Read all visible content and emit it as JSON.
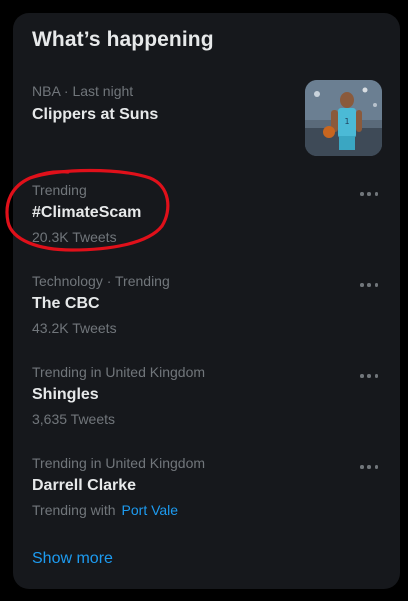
{
  "panel": {
    "title": "What’s happening",
    "show_more": "Show more"
  },
  "trends": [
    {
      "meta": "NBA · Last night",
      "name": "Clippers at Suns",
      "count": "",
      "has_image": true
    },
    {
      "meta": "Trending",
      "name": "#ClimateScam",
      "count": "20.3K Tweets",
      "circled": true
    },
    {
      "meta": "Technology · Trending",
      "name": "The CBC",
      "count": "43.2K Tweets"
    },
    {
      "meta": "Trending in United Kingdom",
      "name": "Shingles",
      "count": "3,635 Tweets"
    },
    {
      "meta": "Trending in United Kingdom",
      "name": "Darrell Clarke",
      "count_prefix": "Trending with",
      "count_link": "Port Vale"
    }
  ],
  "colors": {
    "background": "#000000",
    "panel": "#16181c",
    "primary_text": "#e7e9ea",
    "secondary_text": "#71767b",
    "accent": "#1d9bf0",
    "annotation": "#e0101a"
  },
  "icons": {
    "more": "more-horizontal-icon"
  }
}
